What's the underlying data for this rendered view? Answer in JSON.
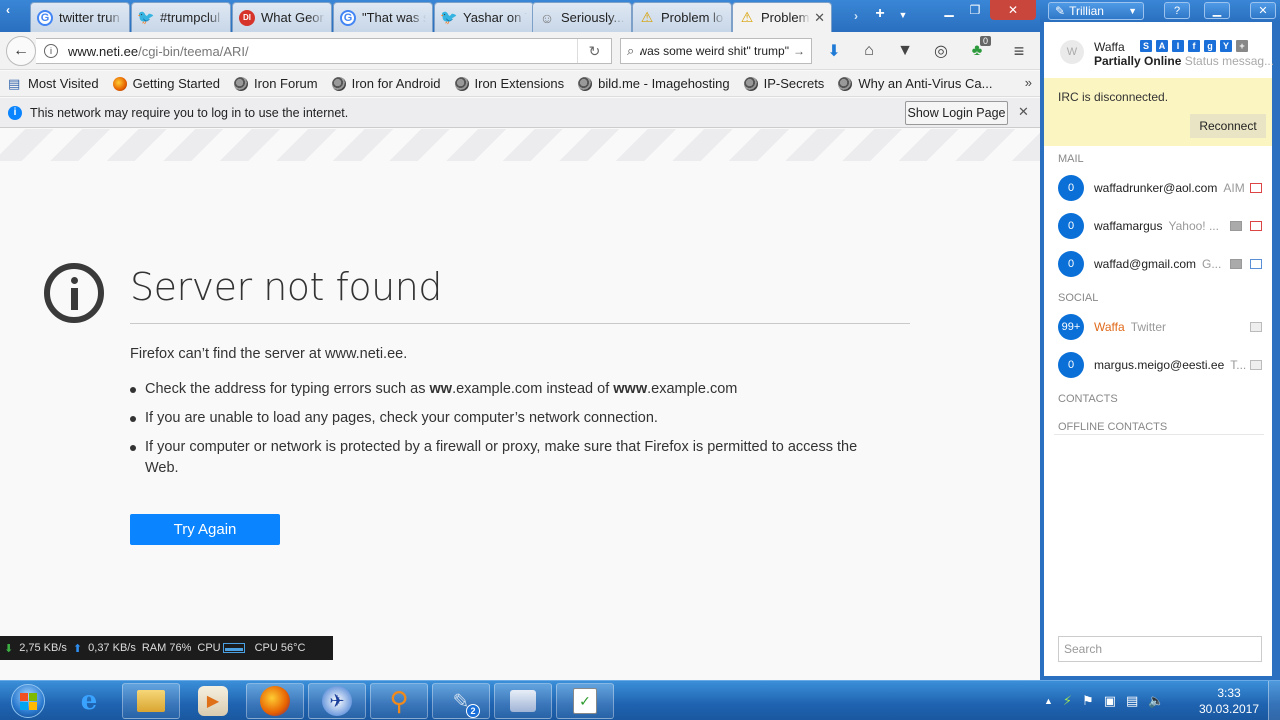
{
  "browser": {
    "tabs": [
      {
        "title": "twitter trun",
        "icon": "google-icon"
      },
      {
        "title": "#trumpclul",
        "icon": "twitter-icon"
      },
      {
        "title": "What Georg",
        "icon": "di-icon"
      },
      {
        "title": "\"That was s",
        "icon": "google-icon"
      },
      {
        "title": "Yashar on T",
        "icon": "twitter-icon"
      },
      {
        "title": "Seriously...",
        "icon": "reddit-icon"
      },
      {
        "title": "Problem lo",
        "icon": "warning-icon"
      },
      {
        "title": "Problem",
        "icon": "warning-icon",
        "active": true
      }
    ],
    "url_host": "www.neti.ee",
    "url_path": "/cgi-bin/teema/ARI/",
    "search_value": "\"That was some weird shit\" trump",
    "sync_badge": "0",
    "bookmarks": [
      {
        "label": "Most Visited",
        "icon": "star-icon"
      },
      {
        "label": "Getting Started",
        "icon": "firefox-icon"
      },
      {
        "label": "Iron Forum",
        "icon": "iron-icon"
      },
      {
        "label": "Iron for Android",
        "icon": "iron-icon"
      },
      {
        "label": "Iron Extensions",
        "icon": "iron-icon"
      },
      {
        "label": "bild.me - Imagehosting",
        "icon": "iron-icon"
      },
      {
        "label": "IP-Secrets",
        "icon": "iron-icon"
      },
      {
        "label": "Why an Anti-Virus Ca...",
        "icon": "iron-icon"
      }
    ],
    "notice": {
      "text": "This network may require you to log in to use the internet.",
      "button": "Show Login Page"
    },
    "error": {
      "title": "Server not found",
      "description": "Firefox can’t find the server at www.neti.ee.",
      "bullet1_a": "Check the address for typing errors such as ",
      "bullet1_b": "ww",
      "bullet1_c": ".example.com instead of ",
      "bullet1_d": "www",
      "bullet1_e": ".example.com",
      "bullet2": "If you are unable to load any pages, check your computer’s network connection.",
      "bullet3": "If your computer or network is protected by a firewall or proxy, make sure that Firefox is permitted to access the Web.",
      "button": "Try Again"
    },
    "netmon": {
      "down": "2,75 KB/s",
      "up": "0,37 KB/s",
      "ram": "RAM 76%",
      "cpu_label": "CPU",
      "cpu_temp": "CPU 56°C"
    }
  },
  "trillian": {
    "title": "Trillian",
    "user_name": "Waffa",
    "avatar_letter": "W",
    "status": "Partially Online",
    "status_message": "Status messag...",
    "irc_text": "IRC is disconnected.",
    "reconnect": "Reconnect",
    "sections": {
      "mail": "MAIL",
      "social": "SOCIAL",
      "contacts": "CONTACTS",
      "offline": "OFFLINE CONTACTS"
    },
    "mail": [
      {
        "count": "0",
        "name": "waffadrunker@aol.com",
        "service": "AIM"
      },
      {
        "count": "0",
        "name": "waffamargus",
        "service": "Yahoo! ..."
      },
      {
        "count": "0",
        "name": "waffad@gmail.com",
        "service": "G..."
      }
    ],
    "social": [
      {
        "count": "99+",
        "name": "Waffa",
        "service": "Twitter"
      },
      {
        "count": "0",
        "name": "margus.meigo@eesti.ee",
        "service": "T..."
      }
    ],
    "search_placeholder": "Search"
  },
  "taskbar": {
    "time": "3:33",
    "date": "30.03.2017",
    "badge": "2"
  }
}
